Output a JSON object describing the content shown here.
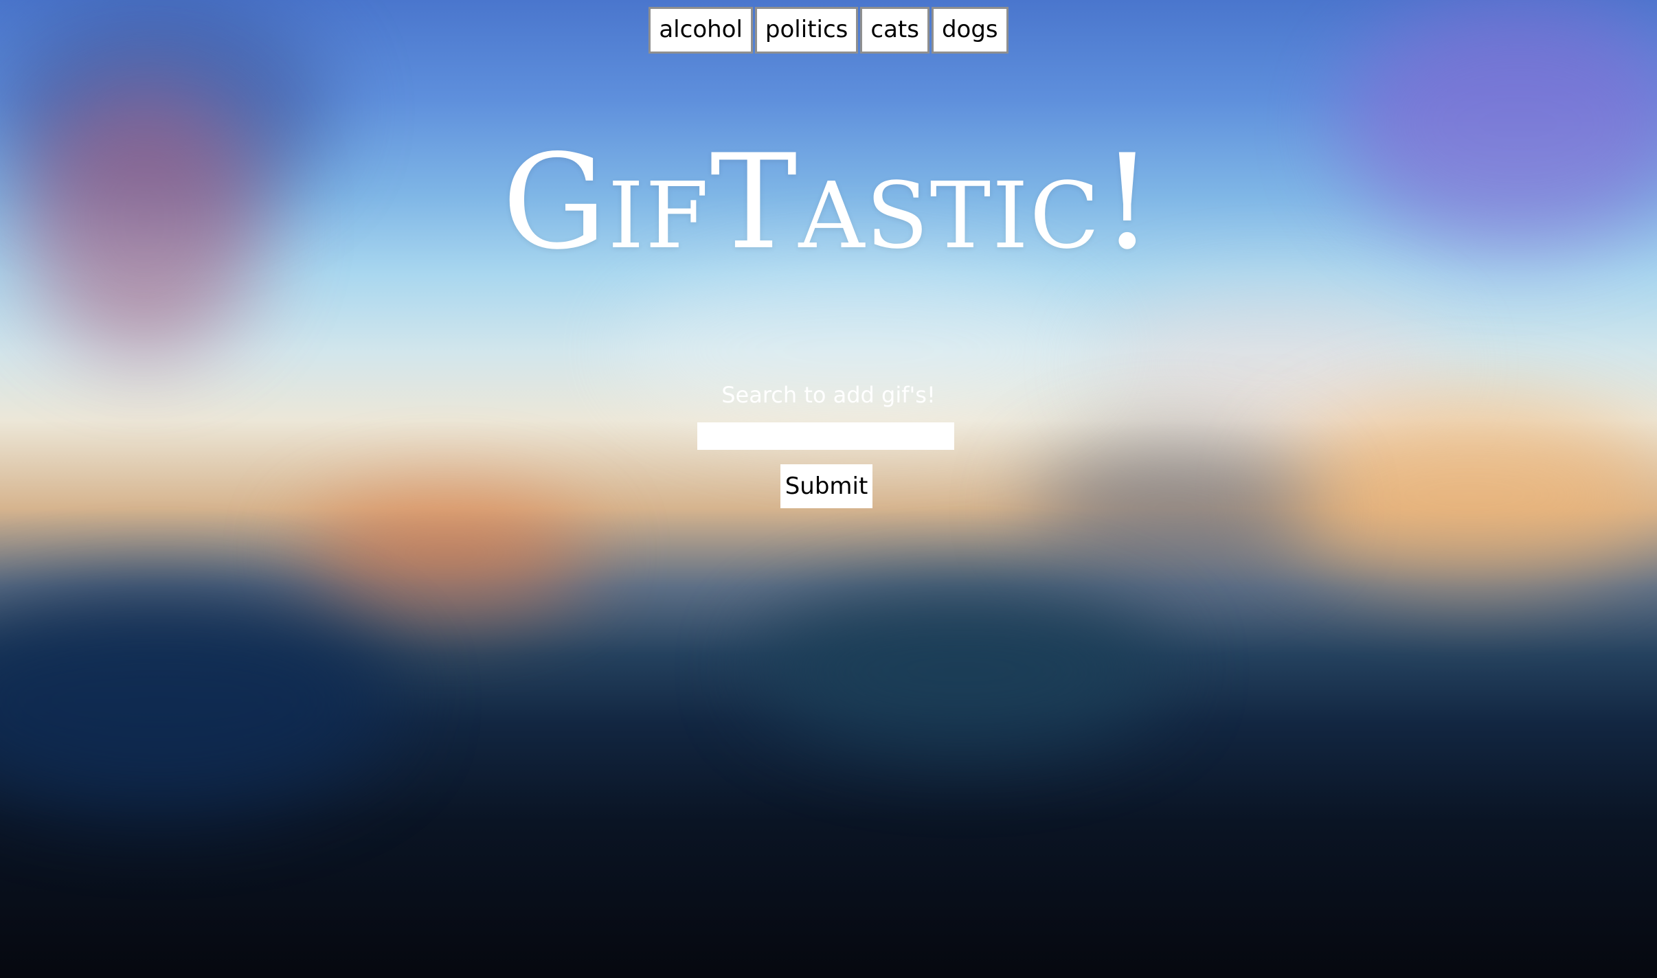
{
  "topics": {
    "buttons": [
      {
        "label": "alcohol"
      },
      {
        "label": "politics"
      },
      {
        "label": "cats"
      },
      {
        "label": "dogs"
      }
    ]
  },
  "header": {
    "title": "GifTastic!"
  },
  "search": {
    "label": "Search to add gif's!",
    "value": "",
    "placeholder": "",
    "submit_label": "Submit"
  },
  "colors": {
    "text": "#ffffff",
    "button_bg": "#ffffff",
    "button_border": "#8f8f8f"
  }
}
